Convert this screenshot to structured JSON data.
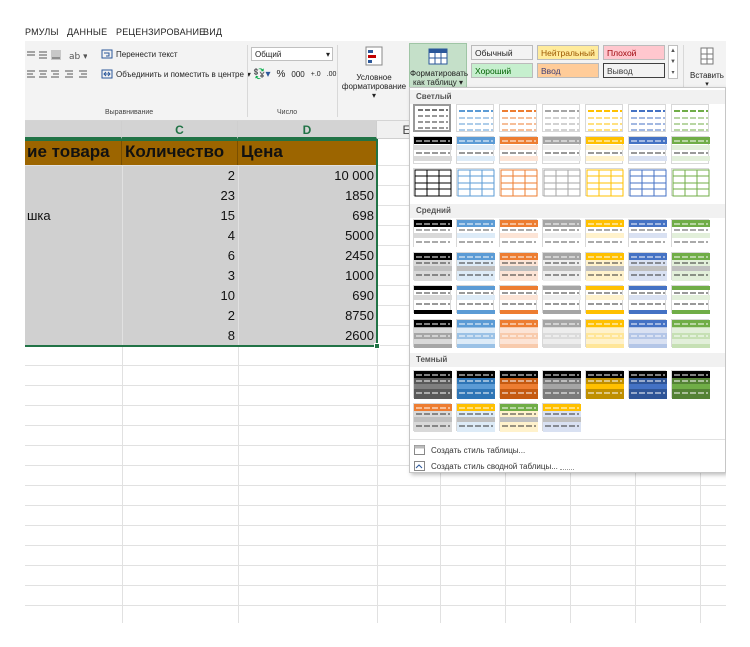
{
  "ribbon": {
    "tabs": [
      "РМУЛЫ",
      "ДАННЫЕ",
      "РЕЦЕНЗИРОВАНИЕ",
      "ВИД"
    ],
    "wrap_text": "Перенести текст",
    "merge_center": "Объединить и поместить в центре",
    "alignment_group": "Выравнивание",
    "number_format": "Общий",
    "percent": "%",
    "thousands": "000",
    "number_group": "Число",
    "conditional_1": "Условное",
    "conditional_2": "форматирование",
    "format_table_1": "Форматировать",
    "format_table_2": "как таблицу",
    "insert": "Вставить",
    "cell_styles": [
      {
        "label": "Обычный",
        "bg": "#ffffff",
        "color": "#000000"
      },
      {
        "label": "Нейтральный",
        "bg": "#ffeb9c",
        "color": "#9c5700"
      },
      {
        "label": "Плохой",
        "bg": "#ffc7ce",
        "color": "#9c0006"
      },
      {
        "label": "Хороший",
        "bg": "#c6efce",
        "color": "#006100"
      },
      {
        "label": "Ввод",
        "bg": "#ffcc99",
        "color": "#3f3f76"
      },
      {
        "label": "Вывод",
        "bg": "#f2f2f2",
        "color": "#3f3f3f"
      }
    ]
  },
  "columns": {
    "c": "C",
    "d": "D",
    "e": "E"
  },
  "table": {
    "headers": [
      "ие товара",
      "Количество",
      "Цена"
    ],
    "rows": [
      {
        "b": "",
        "c": "2",
        "d": "10 000"
      },
      {
        "b": "",
        "c": "23",
        "d": "1850"
      },
      {
        "b": "шка",
        "c": "15",
        "d": "698"
      },
      {
        "b": "",
        "c": "4",
        "d": "5000"
      },
      {
        "b": "",
        "c": "6",
        "d": "2450"
      },
      {
        "b": "",
        "c": "3",
        "d": "1000"
      },
      {
        "b": "",
        "c": "10",
        "d": "690"
      },
      {
        "b": "",
        "c": "2",
        "d": "8750"
      },
      {
        "b": "",
        "c": "8",
        "d": "2600"
      }
    ]
  },
  "gallery": {
    "light": "Светлый",
    "medium": "Средний",
    "dark": "Темный",
    "new_table_style": "Создать стиль таблицы...",
    "new_pivot_style": "Создать стиль сводной таблицы...",
    "palette": [
      "#000000",
      "#5b9bd5",
      "#ed7d31",
      "#a5a5a5",
      "#ffc000",
      "#4472c4",
      "#70ad47"
    ],
    "palette_light": [
      "#d9d9d9",
      "#ddebf7",
      "#fce4d6",
      "#ededed",
      "#fff2cc",
      "#d9e1f2",
      "#e2efda"
    ]
  }
}
